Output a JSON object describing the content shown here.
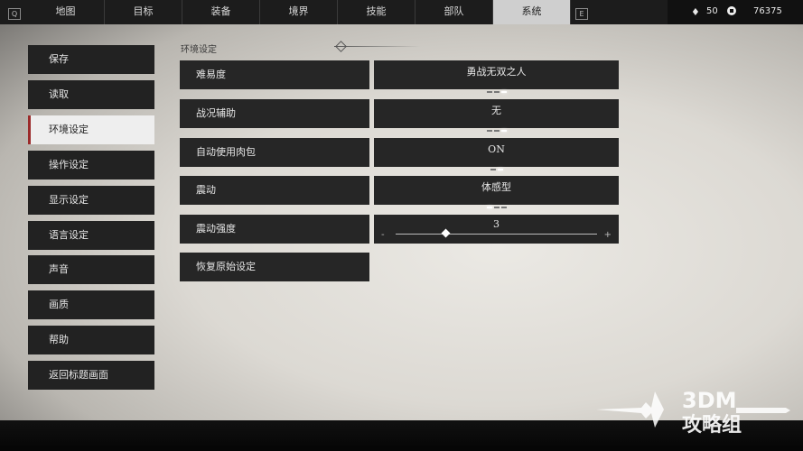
{
  "topbar": {
    "left_key": "Q",
    "right_key": "E",
    "tabs": [
      "地图",
      "目标",
      "装备",
      "境界",
      "技能",
      "部队",
      "系统"
    ],
    "active_tab": "系统",
    "resources": [
      {
        "icon": "diamond-icon",
        "value": "50"
      },
      {
        "icon": "coin-icon",
        "value": "76375"
      }
    ]
  },
  "menu": {
    "items": [
      "保存",
      "读取",
      "环境设定",
      "操作设定",
      "显示设定",
      "语言设定",
      "声音",
      "画质",
      "帮助",
      "返回标题画面"
    ],
    "active": "环境设定"
  },
  "settings": {
    "section_title": "环境设定",
    "rows": [
      {
        "label": "难易度",
        "value": "勇战无双之人",
        "dot_count": 3,
        "dot_selected": 3
      },
      {
        "label": "战况辅助",
        "value": "无",
        "dot_count": 3,
        "dot_selected": 3
      },
      {
        "label": "自动使用肉包",
        "value": "ON",
        "dot_count": 2,
        "dot_selected": 2
      },
      {
        "label": "震动",
        "value": "体感型",
        "dot_count": 3,
        "dot_selected": 1
      },
      {
        "label": "震动强度",
        "value": "3",
        "slider_fraction": 0.25,
        "minus": "-",
        "plus": "+"
      }
    ],
    "reset_label": "恢复原始设定"
  },
  "watermark": {
    "line1": "3DM",
    "line2": "攻略组"
  }
}
